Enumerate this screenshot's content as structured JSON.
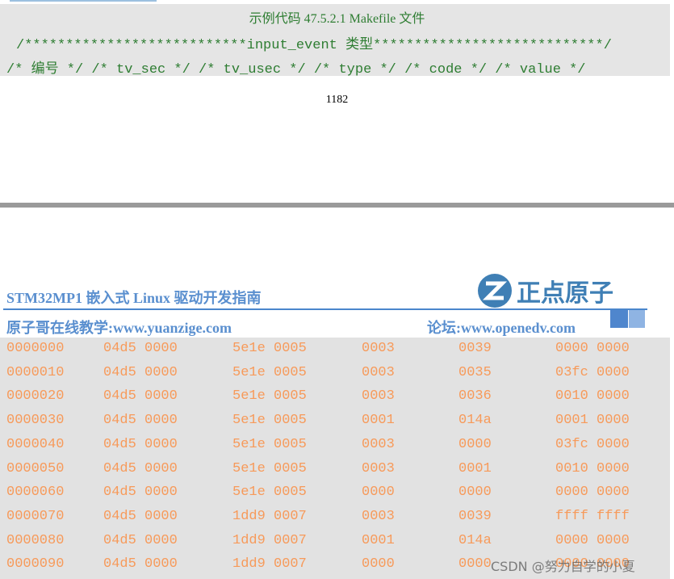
{
  "code_example": {
    "caption": "示例代码 47.5.2.1 Makefile 文件",
    "line1": "/***************************input_event 类型****************************/",
    "line2": "/* 编号 */ /* tv_sec */ /* tv_usec */ /* type */ /* code */ /* value */"
  },
  "page_number": "1182",
  "header": {
    "title": "STM32MP1 嵌入式 Linux 驱动开发指南",
    "logo_text": "正点原子",
    "left_link": "原子哥在线教学:www.yuanzige.com",
    "right_link": "论坛:www.openedv.com"
  },
  "hexdump": [
    [
      "0000000",
      "04d5 0000",
      "5e1e 0005",
      "0003",
      "0039",
      "0000 0000"
    ],
    [
      "0000010",
      "04d5 0000",
      "5e1e 0005",
      "0003",
      "0035",
      "03fc 0000"
    ],
    [
      "0000020",
      "04d5 0000",
      "5e1e 0005",
      "0003",
      "0036",
      "0010 0000"
    ],
    [
      "0000030",
      "04d5 0000",
      "5e1e 0005",
      "0001",
      "014a",
      "0001 0000"
    ],
    [
      "0000040",
      "04d5 0000",
      "5e1e 0005",
      "0003",
      "0000",
      "03fc 0000"
    ],
    [
      "0000050",
      "04d5 0000",
      "5e1e 0005",
      "0003",
      "0001",
      "0010 0000"
    ],
    [
      "0000060",
      "04d5 0000",
      "5e1e 0005",
      "0000",
      "0000",
      "0000 0000"
    ],
    [
      "0000070",
      "04d5 0000",
      "1dd9 0007",
      "0003",
      "0039",
      "ffff ffff"
    ],
    [
      "0000080",
      "04d5 0000",
      "1dd9 0007",
      "0001",
      "014a",
      "0000 0000"
    ],
    [
      "0000090",
      "04d5 0000",
      "1dd9 0007",
      "0000",
      "0000",
      "0000 0000"
    ]
  ],
  "watermark": "CSDN @努力自学的小夏",
  "colors": {
    "code_text": "#2e7d32",
    "hex_text": "#f79a5a",
    "header_blue": "#5a8fcf"
  }
}
